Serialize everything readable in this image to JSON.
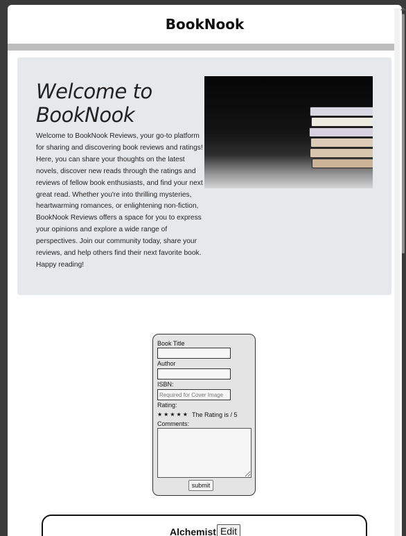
{
  "header": {
    "title": "BookNook"
  },
  "hero": {
    "title": "Welcome to BookNook",
    "body": "Welcome to BookNook Reviews, your go-to platform for sharing and discovering book reviews and ratings! Here, you can share your thoughts on the latest novels, discover new reads through the ratings and reviews of fellow book enthusiasts, and find your next great read. Whether you're into thrilling mysteries, heartwarming romances, or enlightening non-fiction, BookNook Reviews offers a space for you to express your opinions and explore a wide range of perspectives. Join our community today, share your reviews, and help others find their next favorite book. Happy reading!"
  },
  "form": {
    "book_title_label": "Book Title",
    "book_title_value": "",
    "author_label": "Author",
    "author_value": "",
    "isbn_label": "ISBN:",
    "isbn_placeholder": "Required for Cover Image",
    "rating_label": "Rating:",
    "stars": "★★★★★",
    "rating_text": "The Rating is / 5",
    "comments_label": "Comments:",
    "submit_label": "submit"
  },
  "reviews": [
    {
      "title": "Alchemist",
      "edit_label": "Edit"
    }
  ]
}
